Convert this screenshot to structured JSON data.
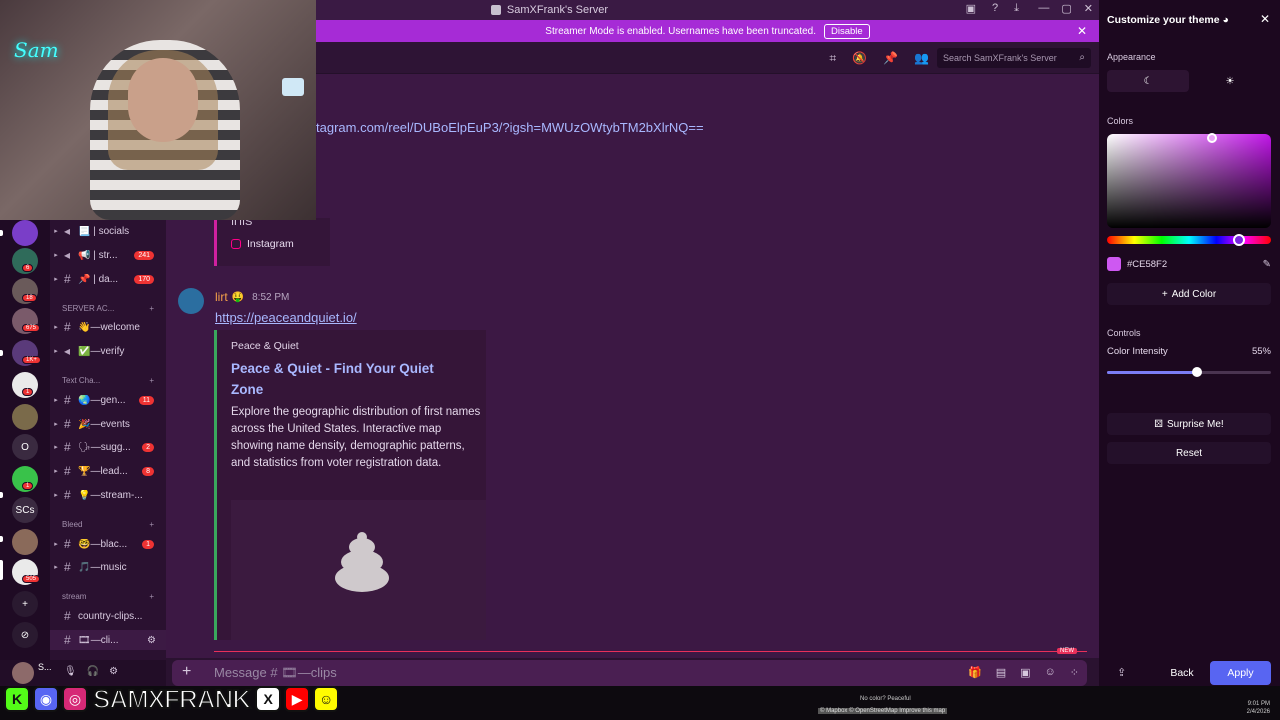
{
  "window": {
    "title": "SamXFrank's Server",
    "controls": [
      "—",
      "▢",
      "✕"
    ]
  },
  "banner": {
    "text": "Streamer Mode is enabled. Usernames have been truncated.",
    "disable_label": "Disable"
  },
  "header": {
    "search_placeholder": "Search SamXFrank's Server"
  },
  "webcam": {
    "neon_text": "Sam"
  },
  "servers": [
    {
      "label": "",
      "badge": "",
      "color": "#7a3ec8"
    },
    {
      "label": "",
      "badge": "6",
      "color": "#2f6b5a"
    },
    {
      "label": "",
      "badge": "18",
      "color": "#6a5a5a"
    },
    {
      "label": "",
      "badge": "675",
      "color": "#7a5a6a"
    },
    {
      "label": "",
      "badge": "1K+",
      "color": "#5a3a7a"
    },
    {
      "label": "",
      "badge": "1",
      "color": "#eaeaea"
    },
    {
      "label": "",
      "badge": "",
      "color": "#7a6a4a"
    },
    {
      "label": "O",
      "badge": "",
      "color": "#3a2a40"
    },
    {
      "label": "",
      "badge": "1",
      "color": "#39c24a"
    },
    {
      "label": "SCs",
      "badge": "",
      "color": "#3a2a40"
    },
    {
      "label": "",
      "badge": "",
      "color": "#8a6a5a"
    },
    {
      "label": "",
      "badge": "505",
      "color": "#eaeaea"
    },
    {
      "label": "+",
      "badge": "",
      "color": "#2a1a30"
    },
    {
      "label": "⊘",
      "badge": "",
      "color": "#2a1a30"
    }
  ],
  "channels": [
    {
      "icon": "📢",
      "name": "📃 | socials",
      "count": ""
    },
    {
      "icon": "📢",
      "name": "📢 | str...",
      "count": "241"
    },
    {
      "icon": "#",
      "name": "📌 | da...",
      "count": "170"
    },
    {
      "icon": "#",
      "name": "👋—welcome",
      "count": ""
    },
    {
      "icon": "📢",
      "name": "✅—verify",
      "count": ""
    },
    {
      "icon": "#",
      "name": "🌏—gen...",
      "count": "11"
    },
    {
      "icon": "#",
      "name": "🎉—events",
      "count": ""
    },
    {
      "icon": "#",
      "name": "🗣—sugg...",
      "count": "2"
    },
    {
      "icon": "#",
      "name": "🏆—lead...",
      "count": "8"
    },
    {
      "icon": "#",
      "name": "💡—stream-...",
      "count": ""
    },
    {
      "icon": "#",
      "name": "🤓—blac...",
      "count": "1"
    },
    {
      "icon": "#",
      "name": "🎵—music",
      "count": ""
    },
    {
      "icon": "#",
      "name": "country-clips...",
      "count": ""
    },
    {
      "icon": "#",
      "name": "🎞—cli...",
      "count": ""
    }
  ],
  "categories": {
    "server_ac": "SERVER AC...",
    "text_cha": "Text Cha...",
    "bleed": "Bleed",
    "stream": "stream"
  },
  "messages": {
    "top_link": "tagram.com/reel/DUBoElpEuP3/?igsh=MWUzOWtybTM2bXlrNQ==",
    "ig_fragment": "ΙΠΙS",
    "ig_site": "Instagram",
    "author": "lirt",
    "author_emoji": "🤑",
    "time": "8:52 PM",
    "link": "https://peaceandquiet.io/",
    "embed": {
      "provider": "Peace & Quiet",
      "title": "Peace & Quiet - Find Your Quiet Zone",
      "description": "Explore the geographic distribution of first names across the United States. Interactive map showing name density, demographic patterns, and statistics from voter registration data."
    },
    "new_tag": "NEW"
  },
  "composer": {
    "placeholder": "Message # 🎞—clips"
  },
  "user": {
    "name": "S..."
  },
  "social_overlay": {
    "handle": "SAMXFRANK"
  },
  "map_overlay": {
    "no_color": "No color? Peaceful",
    "credit": "© Mapbox © OpenStreetMap Improve this map"
  },
  "tray": {
    "time": "9:01 PM",
    "date": "2/4/2026"
  },
  "theme_panel": {
    "title": "Customize your theme",
    "appearance_label": "Appearance",
    "colors_label": "Colors",
    "hex_value": "#CE58F2",
    "swatch_color": "#ce58f2",
    "add_color_label": "Add Color",
    "controls_label": "Controls",
    "intensity_label": "Color Intensity",
    "intensity_value": "55%",
    "intensity_fraction": 0.55,
    "surprise_label": "Surprise Me!",
    "reset_label": "Reset",
    "back_label": "Back",
    "apply_label": "Apply"
  }
}
